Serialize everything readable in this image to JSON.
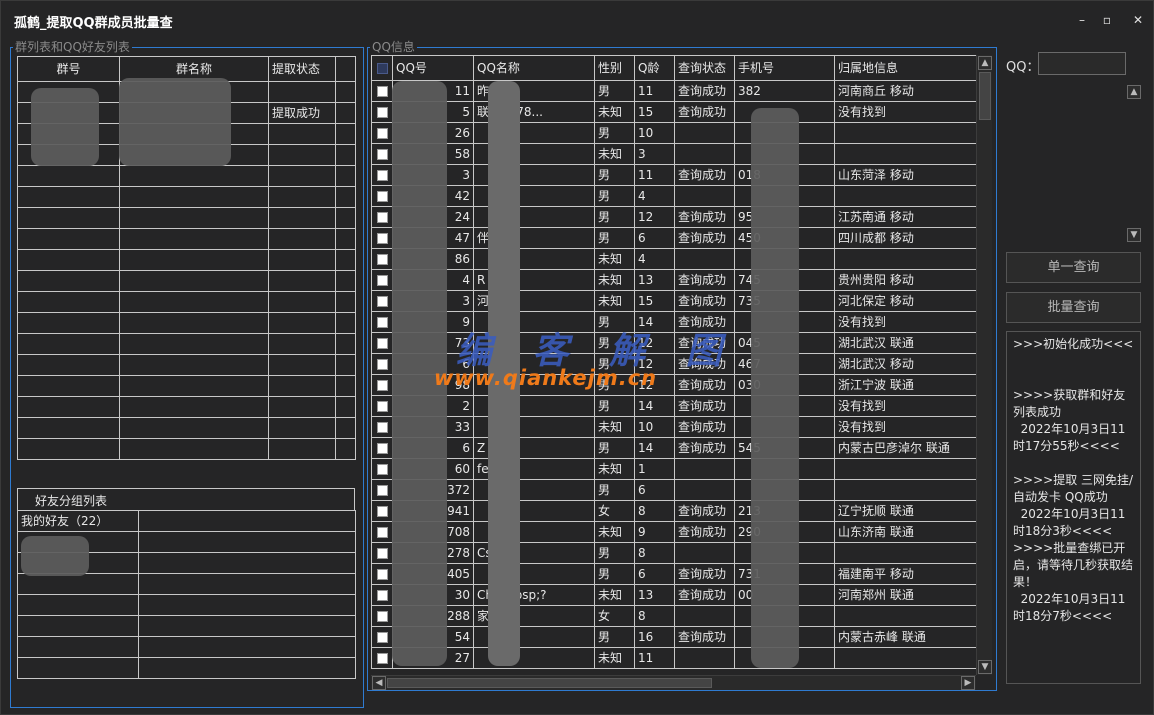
{
  "title": "孤鹤_提取QQ群成员批量查",
  "window_controls": {
    "minimize": "–",
    "maximize": "▫",
    "close": "✕"
  },
  "groups_panel": {
    "label": "群列表和QQ好友列表",
    "columns": [
      "群号",
      "群名称",
      "提取状态"
    ],
    "rows": [
      {
        "id": "",
        "name": "",
        "status": ""
      },
      {
        "id": "",
        "name": "",
        "status": "提取成功"
      },
      {
        "id": "",
        "name": "",
        "status": ""
      }
    ]
  },
  "friends_panel": {
    "header": "好友分组列表",
    "rows": [
      "我的好友（22）"
    ]
  },
  "qq_panel": {
    "label": "QQ信息",
    "columns": [
      "QQ号",
      "QQ名称",
      "性别",
      "Q龄",
      "查询状态",
      "手机号",
      "归属地信息"
    ],
    "rows": [
      {
        "qq": "11",
        "name": "昨",
        "gender": "男",
        "age": "11",
        "status": "查询成功",
        "phone": "382",
        "loc": "河南商丘 移动"
      },
      {
        "qq": "5",
        "name": "联系1978...",
        "gender": "未知",
        "age": "15",
        "status": "查询成功",
        "phone": "",
        "loc": "没有找到"
      },
      {
        "qq": "26",
        "name": "",
        "gender": "男",
        "age": "10",
        "status": "",
        "phone": "",
        "loc": ""
      },
      {
        "qq": "58",
        "name": "",
        "gender": "未知",
        "age": "3",
        "status": "",
        "phone": "",
        "loc": ""
      },
      {
        "qq": "3",
        "name": "",
        "gender": "男",
        "age": "11",
        "status": "查询成功",
        "phone": "018",
        "loc": "山东菏泽 移动"
      },
      {
        "qq": "42",
        "name": "",
        "gender": "男",
        "age": "4",
        "status": "",
        "phone": "",
        "loc": ""
      },
      {
        "qq": "24",
        "name": "",
        "gender": "男",
        "age": "12",
        "status": "查询成功",
        "phone": "95",
        "loc": "江苏南通 移动"
      },
      {
        "qq": "47",
        "name": "伴??",
        "gender": "男",
        "age": "6",
        "status": "查询成功",
        "phone": "450",
        "loc": "四川成都 移动"
      },
      {
        "qq": "86",
        "name": "",
        "gender": "未知",
        "age": "4",
        "status": "",
        "phone": "",
        "loc": ""
      },
      {
        "qq": "4",
        "name": "R",
        "gender": "未知",
        "age": "13",
        "status": "查询成功",
        "phone": "745",
        "loc": "贵州贵阳 移动"
      },
      {
        "qq": "3",
        "name": "河",
        "gender": "未知",
        "age": "15",
        "status": "查询成功",
        "phone": "735",
        "loc": "河北保定 移动"
      },
      {
        "qq": "9",
        "name": "",
        "gender": "男",
        "age": "14",
        "status": "查询成功",
        "phone": "",
        "loc": "没有找到"
      },
      {
        "qq": "73",
        "name": "",
        "gender": "男",
        "age": "12",
        "status": "查询成功",
        "phone": "045",
        "loc": "湖北武汉 联通"
      },
      {
        "qq": "6",
        "name": "",
        "gender": "男",
        "age": "12",
        "status": "查询成功",
        "phone": "467",
        "loc": "湖北武汉 移动"
      },
      {
        "qq": "98",
        "name": "",
        "gender": "男",
        "age": "12",
        "status": "查询成功",
        "phone": "030",
        "loc": "浙江宁波 联通"
      },
      {
        "qq": "2",
        "name": "",
        "gender": "男",
        "age": "14",
        "status": "查询成功",
        "phone": "",
        "loc": "没有找到"
      },
      {
        "qq": "33",
        "name": "",
        "gender": "未知",
        "age": "10",
        "status": "查询成功",
        "phone": "",
        "loc": "没有找到"
      },
      {
        "qq": "6",
        "name": "Z",
        "gender": "男",
        "age": "14",
        "status": "查询成功",
        "phone": "545",
        "loc": "内蒙古巴彦淖尔 联通"
      },
      {
        "qq": "60",
        "name": "fe",
        "gender": "未知",
        "age": "1",
        "status": "",
        "phone": "",
        "loc": ""
      },
      {
        "qq": "372",
        "name": "",
        "gender": "男",
        "age": "6",
        "status": "",
        "phone": "",
        "loc": ""
      },
      {
        "qq": "941",
        "name": "",
        "gender": "女",
        "age": "8",
        "status": "查询成功",
        "phone": "213",
        "loc": "辽宁抚顺 联通"
      },
      {
        "qq": "708",
        "name": "",
        "gender": "未知",
        "age": "9",
        "status": "查询成功",
        "phone": "290",
        "loc": "山东济南 联通"
      },
      {
        "qq": "278",
        "name": "Csure",
        "gender": "男",
        "age": "8",
        "status": "",
        "phone": "",
        "loc": ""
      },
      {
        "qq": "405",
        "name": "",
        "gender": "男",
        "age": "6",
        "status": "查询成功",
        "phone": "731",
        "loc": "福建南平 移动"
      },
      {
        "qq": "30",
        "name": "Cht&nbsp;?",
        "gender": "未知",
        "age": "13",
        "status": "查询成功",
        "phone": "00",
        "loc": "河南郑州 联通"
      },
      {
        "qq": "288",
        "name": "家",
        "gender": "女",
        "age": "8",
        "status": "",
        "phone": "",
        "loc": ""
      },
      {
        "qq": "54",
        "name": "",
        "gender": "男",
        "age": "16",
        "status": "查询成功",
        "phone": "",
        "loc": "内蒙古赤峰 联通"
      },
      {
        "qq": "27",
        "name": "",
        "gender": "未知",
        "age": "11",
        "status": "",
        "phone": "",
        "loc": ""
      }
    ]
  },
  "watermark": {
    "cn": "编 客 解 图",
    "url": "www.qiankejm.cn"
  },
  "qq_field": {
    "label": "QQ：",
    "value": ""
  },
  "buttons": {
    "single": "单一查询",
    "batch": "批量查询"
  },
  "log": [
    ">>>初始化成功<<<",
    "",
    "",
    ">>>>获取群和好友列表成功",
    "  2022年10月3日11时17分55秒<<<<",
    "",
    ">>>>提取 三网免挂/自动发卡 QQ成功",
    "  2022年10月3日11时18分3秒<<<<",
    ">>>>批量查绑已开启，请等待几秒获取结果！",
    "  2022年10月3日11时18分7秒<<<<"
  ]
}
